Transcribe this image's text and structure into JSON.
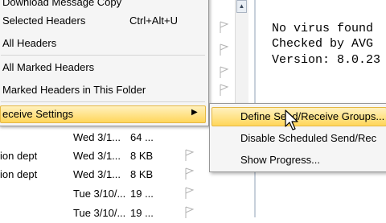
{
  "context_menu": {
    "items": [
      {
        "label": "Download Message Copy",
        "shortcut": ""
      },
      {
        "label": "Selected Headers",
        "shortcut": "Ctrl+Alt+U"
      },
      {
        "label": "All Headers",
        "shortcut": ""
      },
      {
        "label": "All Marked Headers",
        "shortcut": ""
      },
      {
        "label": "Marked Headers in This Folder",
        "shortcut": ""
      },
      {
        "label": "eceive Settings",
        "shortcut": ""
      }
    ],
    "highlighted_index": 5,
    "submenu_arrow": "▶"
  },
  "submenu": {
    "items": [
      {
        "label": "Define Send/Receive Groups..."
      },
      {
        "label": "Disable Scheduled Send/Rec"
      },
      {
        "label": "Show Progress..."
      }
    ],
    "highlighted_index": 0
  },
  "message_list": {
    "rows": [
      {
        "sender": "",
        "date": "Wed 3/1...",
        "size": "64 ..."
      },
      {
        "sender": "ion dept",
        "date": "Wed 3/1...",
        "size": "8 KB"
      },
      {
        "sender": "ion dept",
        "date": "Wed 3/1...",
        "size": "8 KB"
      },
      {
        "sender": "",
        "date": "Tue 3/10/...",
        "size": "19 ..."
      },
      {
        "sender": "",
        "date": "Tue 3/10/...",
        "size": "19 ..."
      }
    ]
  },
  "preview": {
    "lines": [
      "No virus found",
      "Checked by AVG",
      "Version: 8.0.23"
    ]
  },
  "icons": {
    "flag": "flag-icon",
    "scroll_up": "scroll-up-arrow-icon",
    "cursor": "mouse-pointer-icon"
  },
  "colors": {
    "highlight_top": "#fff1bf",
    "highlight_bottom": "#ffd65a",
    "highlight_border": "#e5b744",
    "menu_bg": "#f5f5f5"
  }
}
